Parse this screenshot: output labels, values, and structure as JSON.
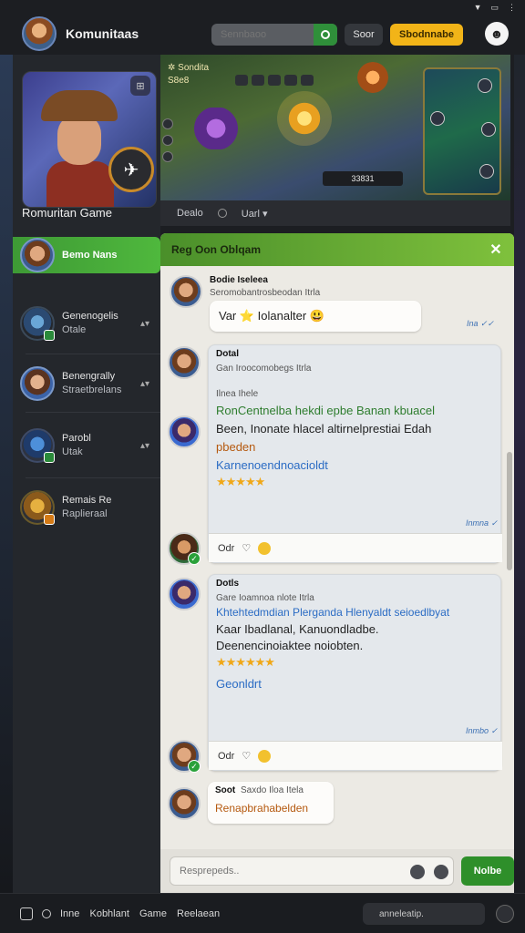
{
  "header": {
    "app_title": "Komunitaas",
    "search_placeholder": "Sennbaoo",
    "button_dark": "Soor",
    "button_yellow": "Sbodnnabe",
    "profile_icon": "profile-icon"
  },
  "sidebar": {
    "game_title": "Romuritan Game",
    "items": [
      {
        "title": "Bemo Nans",
        "sub": ""
      },
      {
        "title": "Genenogelis",
        "sub": "Otale"
      },
      {
        "title": "Benengrally",
        "sub": "Straetbrelans"
      },
      {
        "title": "Parobl",
        "sub": "Utak"
      },
      {
        "title": "Remais Re",
        "sub": "Raplieraal"
      }
    ]
  },
  "gameview": {
    "hud_name": "Sondita",
    "hud_level": "S8e8",
    "status_bar": "33831"
  },
  "subtabs": {
    "tab1": "Dealo",
    "tab2": "Uarl ▾"
  },
  "chat": {
    "title": "Reg Oon Oblqam",
    "messages": [
      {
        "sender": "Bodie Iseleea",
        "meta": "Seromobantrosbeodan Itrla",
        "text": "Var ⭐ Iolanalter 😃",
        "ticks": "Ina ✓✓"
      },
      {
        "sender": "Dotal",
        "meta": "Gan Iroocomobegs Itrla",
        "label": "Ilnea Ihele",
        "line1": "RonCentnelba hekdi epbe Banan kbuacel",
        "line2": "Been, Inonate hlacel altirnelprestiai Edah",
        "line3": "pbeden",
        "line4": "Karnenoendnoacioldt",
        "stars": "★★★★★",
        "ticks": "Inmna ✓",
        "react": "Odr"
      },
      {
        "sender": "Dotls",
        "meta": "Gare Ioamnoa nlote Itrla",
        "line1": "Khtehtedmdian  Plerganda  Hlenyaldt  seioedlbyat",
        "line2": "Kaar  Ibadlanal,  Kanuondladbe.",
        "line3": "Deenencinoiaktee noiobten.",
        "stars": "★★★★★★",
        "line4": "Geonldrt",
        "ticks": "Inmbo ✓",
        "react": "Odr"
      },
      {
        "sender": "Soot",
        "meta": "Saxdo Iloa Itela",
        "text": "Renapbrahabelden"
      }
    ],
    "composer_placeholder": "Resprepeds..",
    "send_label": "Nolbe"
  },
  "bottombar": {
    "items": [
      "Inne",
      "Kobhlant",
      "Game",
      "Reelaean"
    ],
    "search_placeholder": "anneleatip."
  },
  "colors": {
    "accent_green": "#4fb83d",
    "accent_yellow": "#f2b418",
    "chat_bg": "#eceae4"
  }
}
